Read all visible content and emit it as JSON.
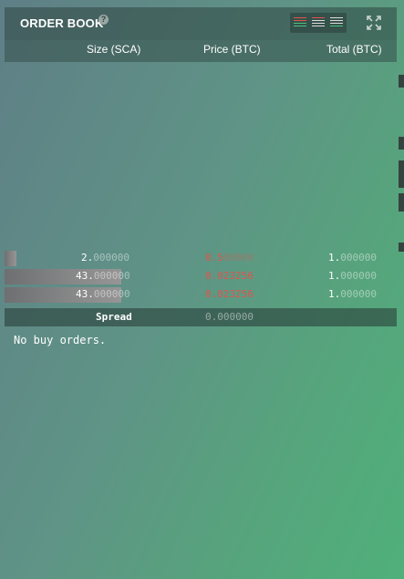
{
  "header": {
    "title": "ORDER BOOK",
    "help": "?"
  },
  "columns": {
    "size": "Size (SCA)",
    "price": "Price (BTC)",
    "total": "Total (BTC)"
  },
  "asks": [
    {
      "size_int": "2.",
      "size_dec": "000000",
      "price_sig": "0.5",
      "price_dim": "00000",
      "total_int": "1.",
      "total_dec": "000000",
      "depth": 0.03
    },
    {
      "size_int": "43.",
      "size_dec": "000000",
      "price_sig": "0.023256",
      "price_dim": "",
      "total_int": "1.",
      "total_dec": "000000",
      "depth": 0.31
    },
    {
      "size_int": "43.",
      "size_dec": "000000",
      "price_sig": "0.023256",
      "price_dim": "",
      "total_int": "1.",
      "total_dec": "000000",
      "depth": 0.31
    }
  ],
  "spread": {
    "label": "Spread",
    "value": "0.000000"
  },
  "bids": {
    "empty_message": "No buy orders."
  },
  "colors": {
    "ask": "#e0544c",
    "panel_header": "#2e4642"
  }
}
